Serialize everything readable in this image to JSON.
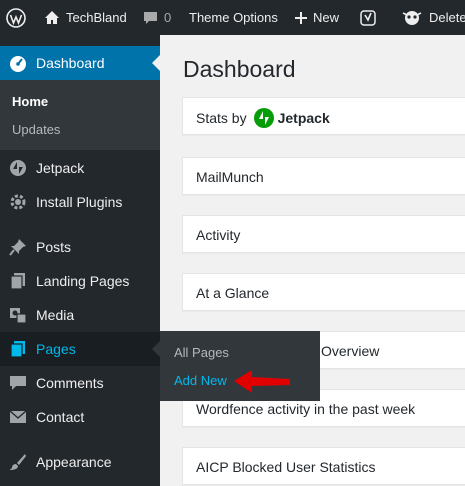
{
  "adminbar": {
    "site_name": "TechBland",
    "comments_count": "0",
    "theme_options": "Theme Options",
    "new_label": "New",
    "plugin_label": "Delete"
  },
  "sidebar": {
    "dashboard": "Dashboard",
    "submenu": {
      "home": "Home",
      "updates": "Updates"
    },
    "items": [
      "Jetpack",
      "Install Plugins",
      "Posts",
      "Landing Pages",
      "Media",
      "Pages",
      "Comments",
      "Contact",
      "Appearance"
    ]
  },
  "flyout": {
    "all_pages": "All Pages",
    "add_new": "Add New"
  },
  "main": {
    "title": "Dashboard",
    "stats_by": "Stats by",
    "jetpack_brand": "Jetpack",
    "boxes": [
      "MailMunch",
      "Activity",
      "At a Glance",
      "Overview",
      "Wordfence activity in the past week",
      "AICP Blocked User Statistics"
    ]
  },
  "colors": {
    "admin_bg": "#23282d",
    "active_blue": "#0073aa",
    "link_blue": "#00b9eb",
    "jetpack_green": "#069e08",
    "annotation_red": "#e00000"
  }
}
